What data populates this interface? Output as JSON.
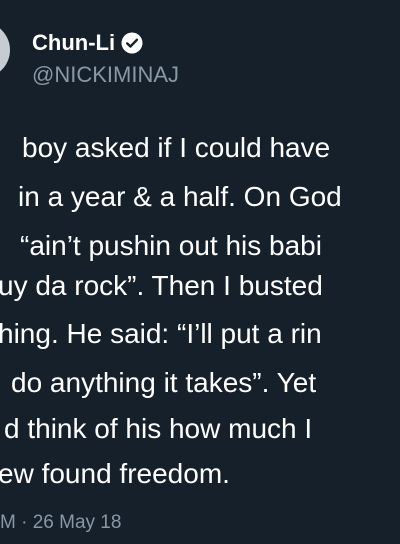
{
  "tweet": {
    "author": {
      "display_name": "Chun-Li",
      "handle": "@NICKIMINAJ",
      "verified_icon": "verified-badge-icon"
    },
    "lines": [
      "boy asked if I could have",
      "in a year & a half. On God",
      "“ain’t pushin out his babi",
      "uy da rock”. Then I busted",
      "hing. He said: “I’ll put a rin",
      "do anything it takes”. Yet",
      "d think of his how much I",
      "ew found freedom."
    ],
    "timestamp": "M · 26 May 18"
  },
  "colors": {
    "background": "#15202b",
    "primary_text": "#ffffff",
    "secondary_text": "#8899a6"
  }
}
